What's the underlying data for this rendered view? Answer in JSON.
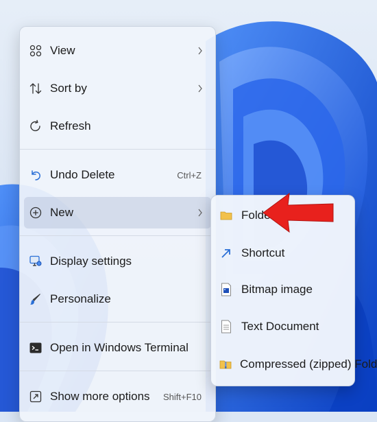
{
  "colors": {
    "accent_blue": "#0a5fd8",
    "arrow_red": "#e8211d",
    "folder_yellow": "#f2c14b"
  },
  "context_menu": {
    "items": [
      {
        "id": "view",
        "label": "View",
        "icon": "view-grid-icon",
        "has_submenu": true
      },
      {
        "id": "sort-by",
        "label": "Sort by",
        "icon": "sort-icon",
        "has_submenu": true
      },
      {
        "id": "refresh",
        "label": "Refresh",
        "icon": "refresh-icon"
      },
      {
        "id": "undo-delete",
        "label": "Undo Delete",
        "icon": "undo-icon",
        "shortcut": "Ctrl+Z"
      },
      {
        "id": "new",
        "label": "New",
        "icon": "new-icon",
        "has_submenu": true,
        "highlighted": true
      },
      {
        "id": "display-settings",
        "label": "Display settings",
        "icon": "display-settings-icon"
      },
      {
        "id": "personalize",
        "label": "Personalize",
        "icon": "personalize-icon"
      },
      {
        "id": "open-terminal",
        "label": "Open in Windows Terminal",
        "icon": "terminal-icon"
      },
      {
        "id": "show-more-options",
        "label": "Show more options",
        "icon": "show-more-icon",
        "shortcut": "Shift+F10"
      }
    ]
  },
  "new_submenu": {
    "items": [
      {
        "id": "folder",
        "label": "Folder",
        "icon": "folder-icon"
      },
      {
        "id": "shortcut",
        "label": "Shortcut",
        "icon": "shortcut-icon"
      },
      {
        "id": "bitmap",
        "label": "Bitmap image",
        "icon": "bitmap-icon"
      },
      {
        "id": "text-document",
        "label": "Text Document",
        "icon": "text-document-icon"
      },
      {
        "id": "compressed-folder",
        "label": "Compressed (zipped) Folder",
        "icon": "zip-folder-icon"
      }
    ]
  }
}
